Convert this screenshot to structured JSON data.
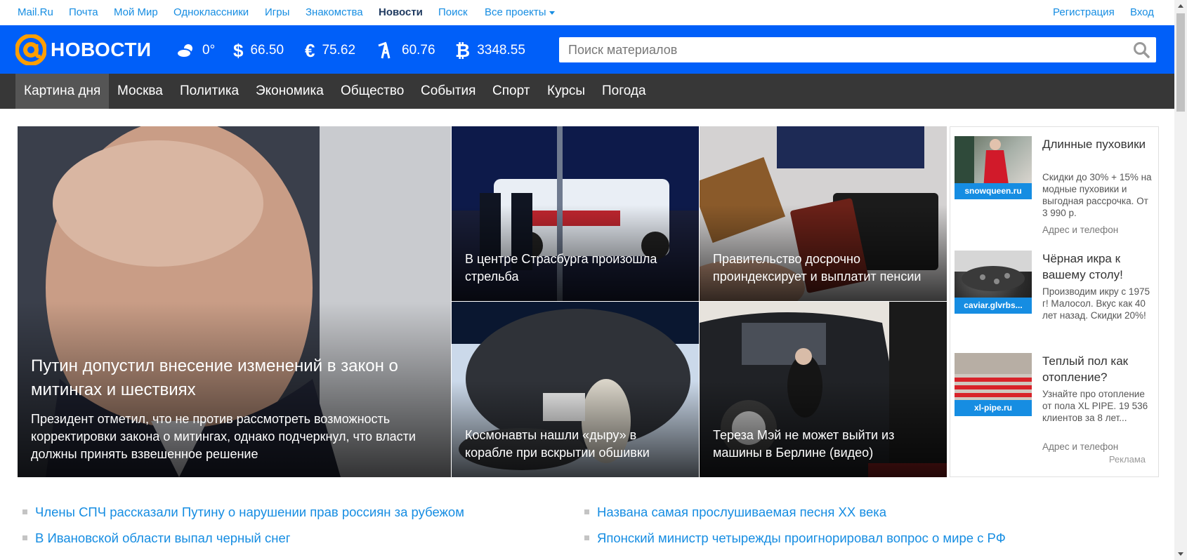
{
  "portal": {
    "links": [
      "Mail.Ru",
      "Почта",
      "Мой Мир",
      "Одноклассники",
      "Игры",
      "Знакомства",
      "Новости",
      "Поиск"
    ],
    "all_projects": "Все проекты",
    "register": "Регистрация",
    "login": "Вход"
  },
  "header": {
    "logo_text": "НОВОСТИ",
    "weather": "0°",
    "usd": "66.50",
    "eur": "75.62",
    "oil": "60.76",
    "btc": "3348.55",
    "search_placeholder": "Поиск материалов"
  },
  "nav": [
    "Картина дня",
    "Москва",
    "Политика",
    "Экономика",
    "Общество",
    "События",
    "Спорт",
    "Курсы",
    "Погода"
  ],
  "main": {
    "lead_title": "Путин допустил внесение изменений в закон о митингах и шествиях",
    "lead_text": "Президент отметил, что не против рассмотреть возможность корректировки закона о митингах, однако подчеркнул, что власти должны принять взвешенное решение",
    "tiles": [
      "В центре Страсбурга произошла стрельба",
      "Правительство досрочно проиндексирует и выплатит пенсии",
      "Космонавты нашли «дыру» в корабле при вскрытии обшивки",
      "Тереза Мэй не может выйти из машины в Берлине (видео)"
    ]
  },
  "ads": {
    "items": [
      {
        "domain": "snowqueen.ru",
        "title": "Длинные пуховики",
        "text": "Скидки до 30% + 15% на модные пуховики и выгодная рассрочка. От 3 990 р.",
        "link": "Адрес и телефон"
      },
      {
        "domain": "caviar.glvrbs...",
        "title": "Чёрная икра к вашему столу!",
        "text": "Производим икру с 1975 г! Малосол. Вкус как 40 лет назад. Скидки 20%!",
        "link": ""
      },
      {
        "domain": "xl-pipe.ru",
        "title": "Теплый пол как отопление?",
        "text": "Узнайте про отопление от пола XL PIPE. 19 536 клиентов за 8 лет...",
        "link": "Адрес и телефон"
      }
    ],
    "label": "Реклама"
  },
  "headlines": [
    "Члены СПЧ рассказали Путину о нарушении прав россиян за рубежом",
    "Названа самая прослушиваемая песня XX века",
    "В Ивановской области выпал черный снег",
    "Японский министр четырежды проигнорировал вопрос о мире с РФ"
  ],
  "colors": {
    "brand_blue": "#005ff9",
    "nav_bg": "#373737",
    "link_blue": "#168de2",
    "logo_orange": "#ff9e00"
  }
}
